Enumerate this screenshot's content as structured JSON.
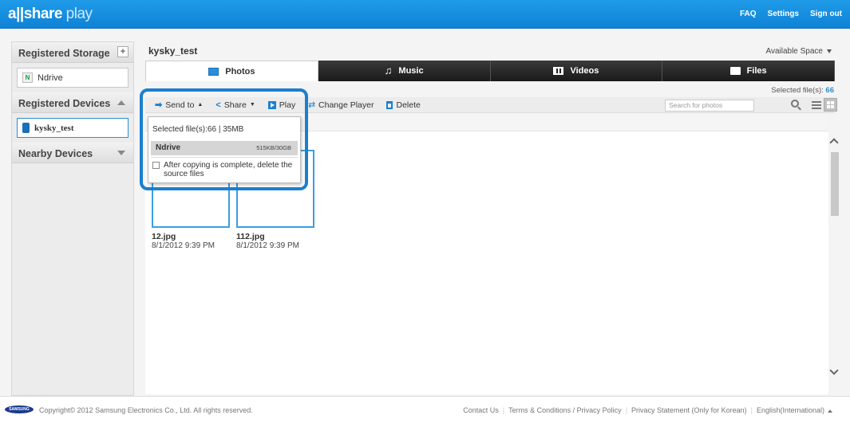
{
  "app": {
    "logo_prefix": "all",
    "logo_main": "share",
    "logo_suffix": " play"
  },
  "header": {
    "links": [
      "FAQ",
      "Settings",
      "Sign out"
    ]
  },
  "sidebar": {
    "registered_storage": "Registered Storage",
    "storage_item": "Ndrive",
    "storage_badge": "N",
    "registered_devices": "Registered Devices",
    "device_item": "kysky_test",
    "nearby_devices": "Nearby Devices"
  },
  "main": {
    "device_title": "kysky_test",
    "available_space": "Available Space",
    "tabs": [
      {
        "label": "Photos",
        "icon": "photo-icon"
      },
      {
        "label": "Music",
        "icon": "music-note-icon"
      },
      {
        "label": "Videos",
        "icon": "film-icon"
      },
      {
        "label": "Files",
        "icon": "folder-icon"
      }
    ],
    "selected_files_label": "Selected file(s): ",
    "selected_files_count": "66",
    "toolbar": {
      "send_to": "Send to",
      "share": "Share",
      "play": "Play",
      "change_player": "Change Player",
      "delete": "Delete"
    },
    "search_placeholder": "Search for photos",
    "photos": [
      {
        "name": "12.jpg",
        "date": "8/1/2012 9:39 PM"
      },
      {
        "name": "112.jpg",
        "date": "8/1/2012 9:39 PM"
      }
    ]
  },
  "dropdown": {
    "summary": "Selected file(s):66 | 35MB",
    "storage_name": "Ndrive",
    "storage_size": "515KB/30GB",
    "delete_option": "After copying is complete, delete the source files"
  },
  "footer": {
    "brand": "SAMSUNG",
    "copyright": "Copyright© 2012 Samsung Electronics Co., Ltd. All rights reserved.",
    "links": [
      "Contact Us",
      "Terms & Conditions / Privacy Policy",
      "Privacy Statement (Only for Korean)",
      "English(International)"
    ]
  },
  "colors": {
    "accent": "#1b7fcf",
    "topbar": "#1590e0"
  }
}
